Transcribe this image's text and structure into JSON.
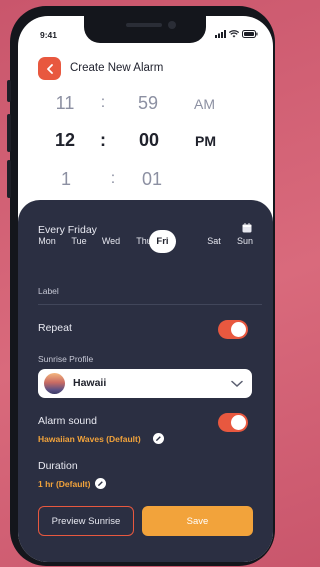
{
  "status_bar": {
    "time": "9:41"
  },
  "header": {
    "title": "Create New Alarm"
  },
  "time_picker": {
    "hours": [
      "11",
      "12",
      "1"
    ],
    "separator": ":",
    "minutes": [
      "59",
      "00",
      "01"
    ],
    "ampm": [
      "AM",
      "PM"
    ],
    "selected": {
      "hour": "12",
      "minute": "00",
      "ampm": "PM"
    }
  },
  "schedule": {
    "summary": "Every Friday",
    "days": [
      "Mon",
      "Tue",
      "Wed",
      "Thu",
      "Fri",
      "Sat",
      "Sun"
    ],
    "selected_day": "Fri"
  },
  "label_field": {
    "placeholder": "Label",
    "value": ""
  },
  "repeat": {
    "label": "Repeat",
    "on": true
  },
  "sunrise_profile": {
    "label": "Sunrise Profile",
    "value": "Hawaii"
  },
  "alarm_sound": {
    "label": "Alarm sound",
    "on": true,
    "value": "Hawaiian Waves (Default)"
  },
  "duration": {
    "label": "Duration",
    "value": "1 hr (Default)"
  },
  "buttons": {
    "preview": "Preview Sunrise",
    "save": "Save"
  },
  "colors": {
    "accent": "#e8583f",
    "highlight": "#f2a33b",
    "sheet": "#2b2f42",
    "background": "#d96a7c"
  },
  "icons": [
    "back-chevron-icon",
    "calendar-icon",
    "chevron-down-icon",
    "edit-icon",
    "wifi-icon",
    "battery-icon",
    "signal-icon"
  ]
}
